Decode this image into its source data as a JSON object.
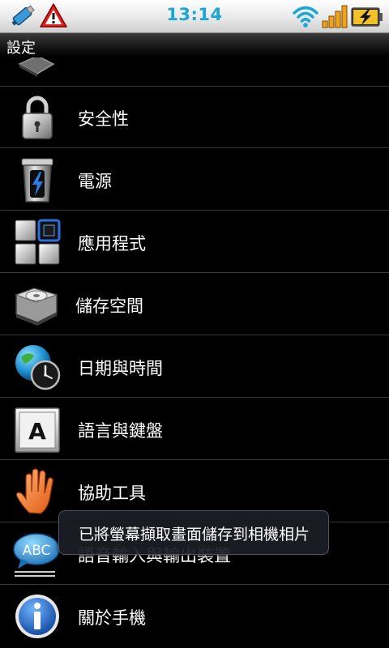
{
  "status_bar": {
    "time": "13:14",
    "icons": [
      "usb-debug-icon",
      "warning-icon",
      "wifi-icon",
      "signal-icon",
      "battery-charging-icon"
    ],
    "accent_color": "#1aa6d6"
  },
  "title_bar": {
    "title": "設定"
  },
  "settings_list": {
    "items": [
      {
        "label": "",
        "icon": "partial-item-icon"
      },
      {
        "label": "安全性",
        "icon": "lock-icon"
      },
      {
        "label": "電源",
        "icon": "power-trash-icon"
      },
      {
        "label": "應用程式",
        "icon": "applications-grid-icon"
      },
      {
        "label": "儲存空間",
        "icon": "hard-drive-icon"
      },
      {
        "label": "日期與時間",
        "icon": "globe-clock-icon"
      },
      {
        "label": "語言與鍵盤",
        "icon": "letter-a-key-icon"
      },
      {
        "label": "協助工具",
        "icon": "hand-icon"
      },
      {
        "label": "語音輸入與輸出裝置",
        "icon": "abc-speech-bubble-icon"
      },
      {
        "label": "關於手機",
        "icon": "info-icon"
      }
    ]
  },
  "toast": {
    "message": "已將螢幕擷取畫面儲存到相機相片"
  }
}
